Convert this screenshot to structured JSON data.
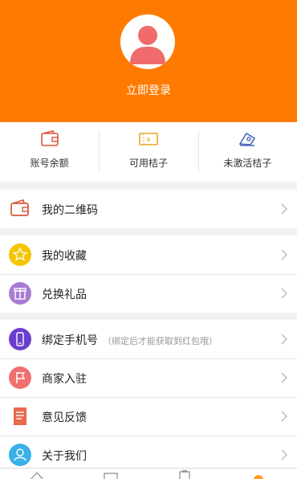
{
  "profile": {
    "login_label": "立即登录",
    "header_color": "#ff7a00",
    "avatar_color": "#f06c6c"
  },
  "stats": [
    {
      "label": "账号余额",
      "icon": "wallet-icon"
    },
    {
      "label": "可用桔子",
      "icon": "coupon-icon"
    },
    {
      "label": "未激活桔子",
      "icon": "ticket-icon"
    }
  ],
  "menu": {
    "qrcode": {
      "label": "我的二维码",
      "icon": "wallet-icon"
    },
    "favorites": {
      "label": "我的收藏",
      "icon": "star-icon"
    },
    "gifts": {
      "label": "兑换礼品",
      "icon": "gift-icon"
    },
    "bind_phone": {
      "label": "绑定手机号",
      "note": "（绑定后才能获取到红包哦）",
      "icon": "phone-icon"
    },
    "merchant": {
      "label": "商家入驻",
      "icon": "flag-icon"
    },
    "feedback": {
      "label": "意见反馈",
      "icon": "document-icon"
    },
    "about": {
      "label": "关于我们",
      "icon": "person-icon"
    }
  },
  "colors": {
    "star": "#f5c400",
    "gift": "#a97ad6",
    "phone": "#6a3fd0",
    "merchant": "#f07070",
    "feedback": "#e96a4a",
    "about": "#3ab0e8"
  }
}
